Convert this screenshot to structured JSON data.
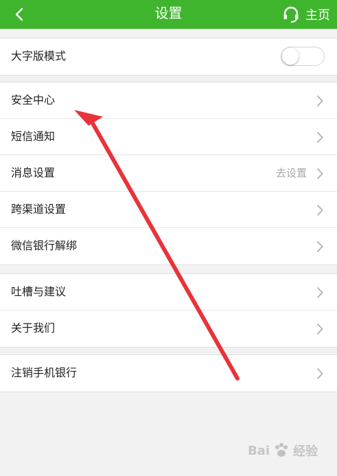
{
  "header": {
    "title": "设置",
    "home_label": "主页",
    "bg_color": "#3fb52d"
  },
  "groups": [
    {
      "items": [
        {
          "label": "大字版模式",
          "control": "toggle",
          "toggle_on": false
        }
      ]
    },
    {
      "items": [
        {
          "label": "安全中心",
          "control": "chevron"
        },
        {
          "label": "短信通知",
          "control": "chevron"
        },
        {
          "label": "消息设置",
          "value": "去设置",
          "control": "chevron"
        },
        {
          "label": "跨渠道设置",
          "control": "chevron"
        },
        {
          "label": "微信银行解绑",
          "control": "chevron"
        }
      ]
    },
    {
      "items": [
        {
          "label": "吐槽与建议",
          "control": "chevron"
        },
        {
          "label": "关于我们",
          "control": "chevron"
        }
      ]
    },
    {
      "items": [
        {
          "label": "注销手机银行",
          "control": "chevron"
        }
      ]
    }
  ],
  "watermark": {
    "text": "Bai",
    "text2": "经验"
  },
  "annotation_arrow_color": "#e8333a"
}
